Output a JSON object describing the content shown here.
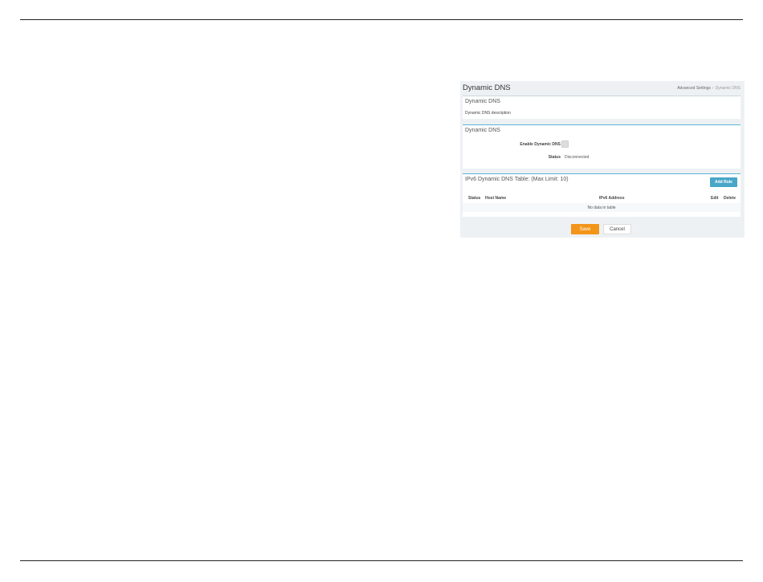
{
  "page": {
    "title": "Dynamic DNS"
  },
  "breadcrumb": {
    "parent": "Advanced Settings",
    "separator": "›",
    "current": "Dynamic DNS"
  },
  "section_info": {
    "title": "Dynamic DNS",
    "description": "Dynamic DNS description"
  },
  "section_settings": {
    "title": "Dynamic DNS",
    "enable_label": "Enable Dynamic DNS",
    "enable_checked": false,
    "status_label": "Status",
    "status_value": "Disconnected"
  },
  "section_table": {
    "title": "IPv6 Dynamic DNS Table: (Max Limit: 10)",
    "add_rule_label": "Add Rule",
    "columns": {
      "status": "Status",
      "host_name": "Host Name",
      "ipv6_address": "IPv6 Address",
      "edit": "Edit",
      "delete": "Delete"
    },
    "empty_message": "No data in table"
  },
  "actions": {
    "save_label": "Save",
    "cancel_label": "Cancel"
  },
  "colors": {
    "accent": "#49a6c8",
    "save": "#f39519",
    "panel_bg": "#eef1f4"
  }
}
